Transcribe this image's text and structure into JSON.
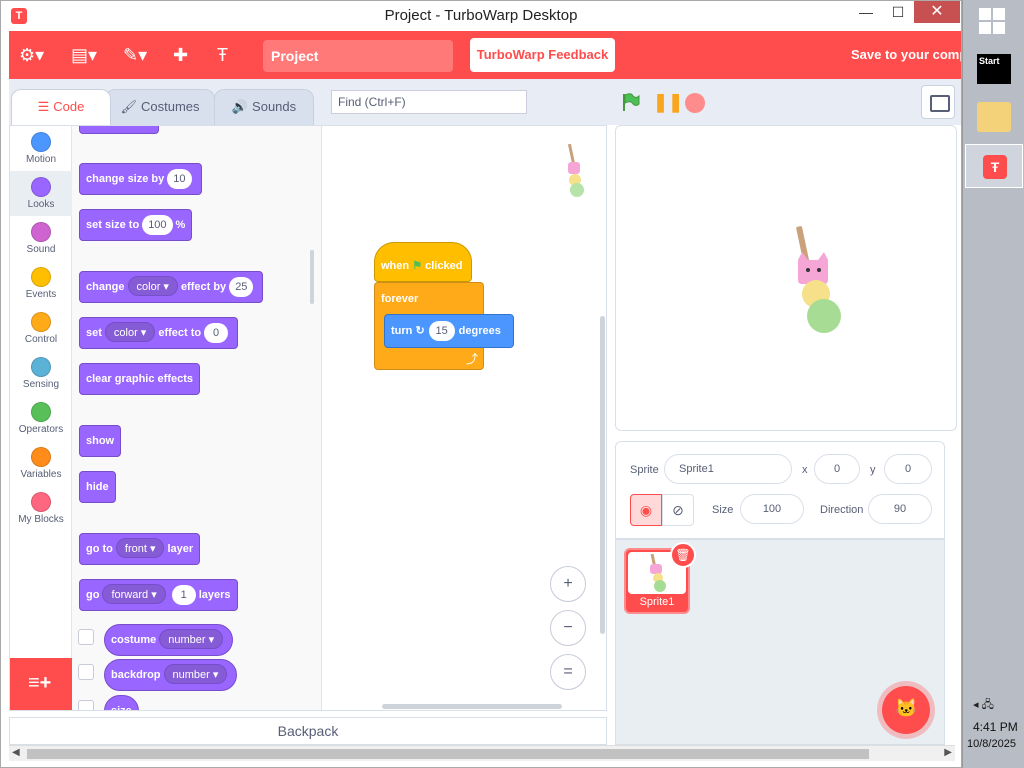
{
  "window": {
    "title": "Project - TurboWarp Desktop",
    "min_symbol": "—",
    "max_symbol": "☐",
    "close_symbol": "✕"
  },
  "menubar": {
    "project_title": "Project",
    "feedback_label": "TurboWarp Feedback",
    "save_label": "Save to your computer",
    "icons": [
      "gear-icon",
      "file-icon",
      "edit-icon",
      "puzzle-icon",
      "turbowarp-icon"
    ]
  },
  "tabs": {
    "code": "Code",
    "costumes": "Costumes",
    "sounds": "Sounds",
    "active": "code"
  },
  "find": {
    "placeholder": "Find (Ctrl+F)"
  },
  "categories": [
    {
      "label": "Motion",
      "color": "#4c97ff"
    },
    {
      "label": "Looks",
      "color": "#9966ff"
    },
    {
      "label": "Sound",
      "color": "#cf63cf"
    },
    {
      "label": "Events",
      "color": "#ffbf00"
    },
    {
      "label": "Control",
      "color": "#ffab19"
    },
    {
      "label": "Sensing",
      "color": "#5cb1d6"
    },
    {
      "label": "Operators",
      "color": "#59c059"
    },
    {
      "label": "Variables",
      "color": "#ff8c1a"
    },
    {
      "label": "My Blocks",
      "color": "#ff6680"
    }
  ],
  "palette": {
    "change_size": {
      "text": "change size by",
      "value": "10"
    },
    "set_size": {
      "text": "set size to",
      "value": "100",
      "unit": "%"
    },
    "change_effect": {
      "text1": "change",
      "effect": "color",
      "text2": "effect by",
      "value": "25"
    },
    "set_effect": {
      "text1": "set",
      "effect": "color",
      "text2": "effect to",
      "value": "0"
    },
    "clear_effects": "clear graphic effects",
    "show": "show",
    "hide": "hide",
    "go_to_layer": {
      "text1": "go to",
      "option": "front",
      "text2": "layer"
    },
    "go_layers": {
      "text1": "go",
      "option": "forward",
      "value": "1",
      "text2": "layers"
    },
    "costume_reporter": {
      "text": "costume",
      "option": "number"
    },
    "backdrop_reporter": {
      "text": "backdrop",
      "option": "number"
    },
    "size_reporter": "size"
  },
  "script": {
    "when": "when",
    "clicked": "clicked",
    "forever": "forever",
    "turn": "turn",
    "turn_value": "15",
    "degrees": "degrees"
  },
  "zoom": {
    "in": "+",
    "out": "−",
    "reset": "="
  },
  "backpack": "Backpack",
  "sprite_info": {
    "sprite_label": "Sprite",
    "sprite_name": "Sprite1",
    "x_label": "x",
    "x_value": "0",
    "y_label": "y",
    "y_value": "0",
    "size_label": "Size",
    "size_value": "100",
    "direction_label": "Direction",
    "direction_value": "90"
  },
  "sprites": [
    {
      "name": "Sprite1",
      "selected": true
    }
  ],
  "taskbar": {
    "start_label": "Start",
    "time": "4:41 PM",
    "date": "10/8/2025"
  },
  "colors": {
    "accent": "#ff4c4c",
    "looks": "#9966ff",
    "motion": "#4c97ff",
    "events": "#ffbf00",
    "control": "#ffab19"
  }
}
